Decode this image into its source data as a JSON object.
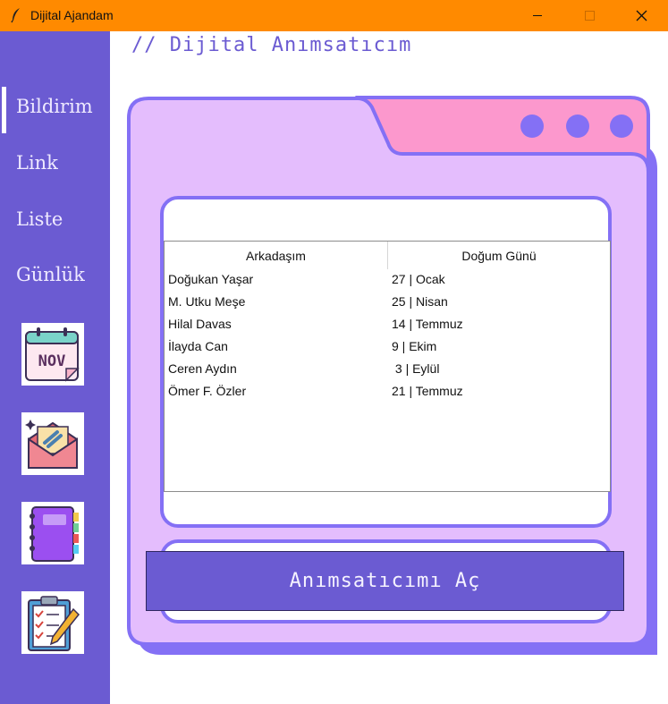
{
  "window": {
    "title": "Dijital Ajandam"
  },
  "sidebar": {
    "items": [
      {
        "label": "Bildirim"
      },
      {
        "label": "Link"
      },
      {
        "label": "Liste"
      },
      {
        "label": "Günlük"
      }
    ],
    "calendar_text": "NOV"
  },
  "heading": "// Dijital Anımsatıcım",
  "table": {
    "columns": [
      "Arkadaşım",
      "Doğum Günü"
    ],
    "rows": [
      [
        "Doğukan Yaşar",
        "27 | Ocak"
      ],
      [
        "M. Utku Meşe",
        "25 | Nisan"
      ],
      [
        "Hilal Davas",
        "14 | Temmuz"
      ],
      [
        "İlayda Can",
        "9 | Ekim"
      ],
      [
        "Ceren Aydın",
        " 3 | Eylül"
      ],
      [
        "Ömer F. Özler",
        "21 | Temmuz"
      ]
    ]
  },
  "open_button": "Anımsatıcımı Aç",
  "colors": {
    "titlebar": "#ff8a00",
    "sidebar": "#6b5bd2",
    "folder": "#e4bdfd",
    "folder_tab": "#fc98cd",
    "outline": "#8470f5"
  }
}
